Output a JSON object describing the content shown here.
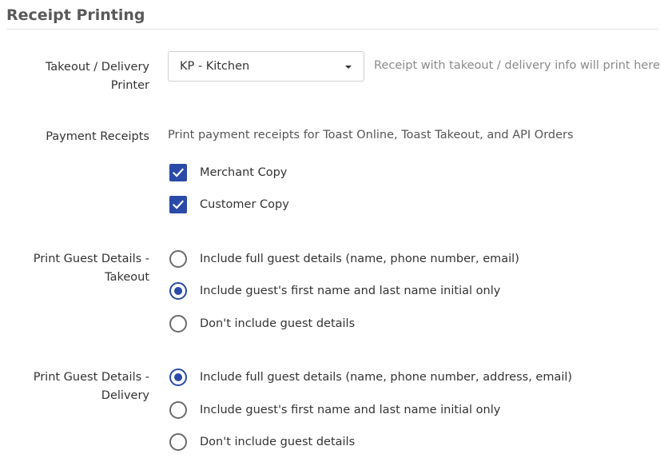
{
  "section": {
    "title": "Receipt Printing"
  },
  "colors": {
    "accent": "#2b4aa8",
    "text": "#333333",
    "muted": "#8a8a8a",
    "divider": "#e2e2e2"
  },
  "takeout_printer": {
    "label_line1": "Takeout / Delivery",
    "label_line2": "Printer",
    "selected": "KP - Kitchen",
    "hint": "Receipt with takeout / delivery info will print here."
  },
  "payment_receipts": {
    "label": "Payment Receipts",
    "description": "Print payment receipts for Toast Online, Toast Takeout, and API Orders",
    "options": [
      {
        "label": "Merchant Copy",
        "checked": true
      },
      {
        "label": "Customer Copy",
        "checked": true
      }
    ]
  },
  "guest_takeout": {
    "label_line1": "Print Guest Details -",
    "label_line2": "Takeout",
    "options": [
      {
        "label": "Include full guest details (name, phone number, email)",
        "checked": false
      },
      {
        "label": "Include guest's first name and last name initial only",
        "checked": true
      },
      {
        "label": "Don't include guest details",
        "checked": false
      }
    ]
  },
  "guest_delivery": {
    "label_line1": "Print Guest Details -",
    "label_line2": "Delivery",
    "options": [
      {
        "label": "Include full guest details (name, phone number, address, email)",
        "checked": true
      },
      {
        "label": "Include guest's first name and last name initial only",
        "checked": false
      },
      {
        "label": "Don't include guest details",
        "checked": false
      }
    ]
  }
}
